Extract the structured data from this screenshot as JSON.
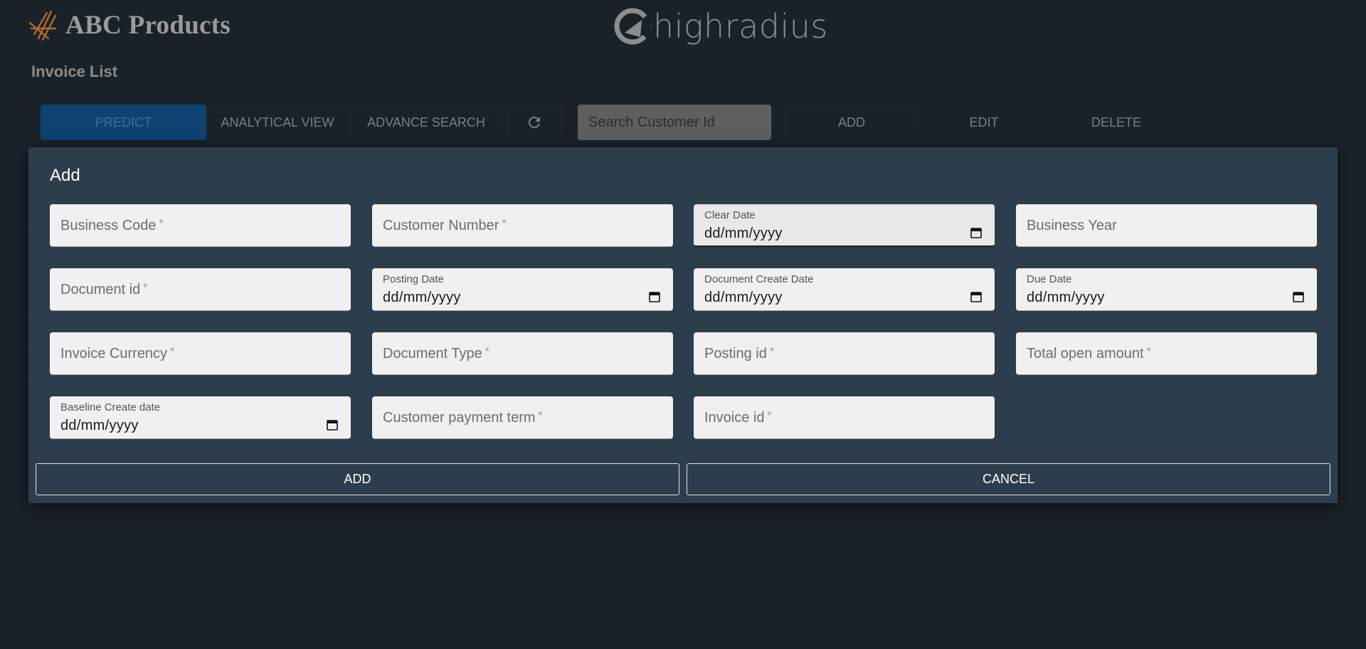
{
  "header": {
    "brand": "ABC Products",
    "partner_logo": "highradius",
    "page_title": "Invoice List"
  },
  "toolbar": {
    "predict": "PREDICT",
    "analytical_view": "ANALYTICAL VIEW",
    "advance_search": "ADVANCE SEARCH",
    "refresh_icon": "refresh-icon",
    "search_placeholder": "Search Customer Id",
    "add": "ADD",
    "edit": "EDIT",
    "delete": "DELETE"
  },
  "modal": {
    "title": "Add",
    "fields": {
      "business_code": {
        "placeholder": "Business Code",
        "required": "*"
      },
      "customer_number": {
        "placeholder": "Customer Number",
        "required": "*"
      },
      "clear_date": {
        "label": "Clear Date",
        "value": "dd/mm/yyyy"
      },
      "business_year": {
        "placeholder": "Business Year"
      },
      "document_id": {
        "placeholder": "Document id",
        "required": "*"
      },
      "posting_date": {
        "label": "Posting Date",
        "value": "dd/mm/yyyy"
      },
      "document_create_date": {
        "label": "Document Create Date",
        "value": "dd/mm/yyyy"
      },
      "due_date": {
        "label": "Due Date",
        "value": "dd/mm/yyyy"
      },
      "invoice_currency": {
        "placeholder": "Invoice Currency",
        "required": "*"
      },
      "document_type": {
        "placeholder": "Document Type",
        "required": "*"
      },
      "posting_id": {
        "placeholder": "Posting id",
        "required": "*"
      },
      "total_open_amount": {
        "placeholder": "Total open amount",
        "required": "*"
      },
      "baseline_create_date": {
        "label": "Baseline Create date",
        "value": "dd/mm/yyyy"
      },
      "customer_payment_term": {
        "placeholder": "Customer payment term",
        "required": "*"
      },
      "invoice_id": {
        "placeholder": "Invoice id",
        "required": "*"
      }
    },
    "add_button": "ADD",
    "cancel_button": "CANCEL"
  },
  "colors": {
    "background": "#1a2229",
    "modal_bg": "#2c3e4d",
    "predict_bg": "#0e4270",
    "field_bg": "#f0f0f0"
  }
}
